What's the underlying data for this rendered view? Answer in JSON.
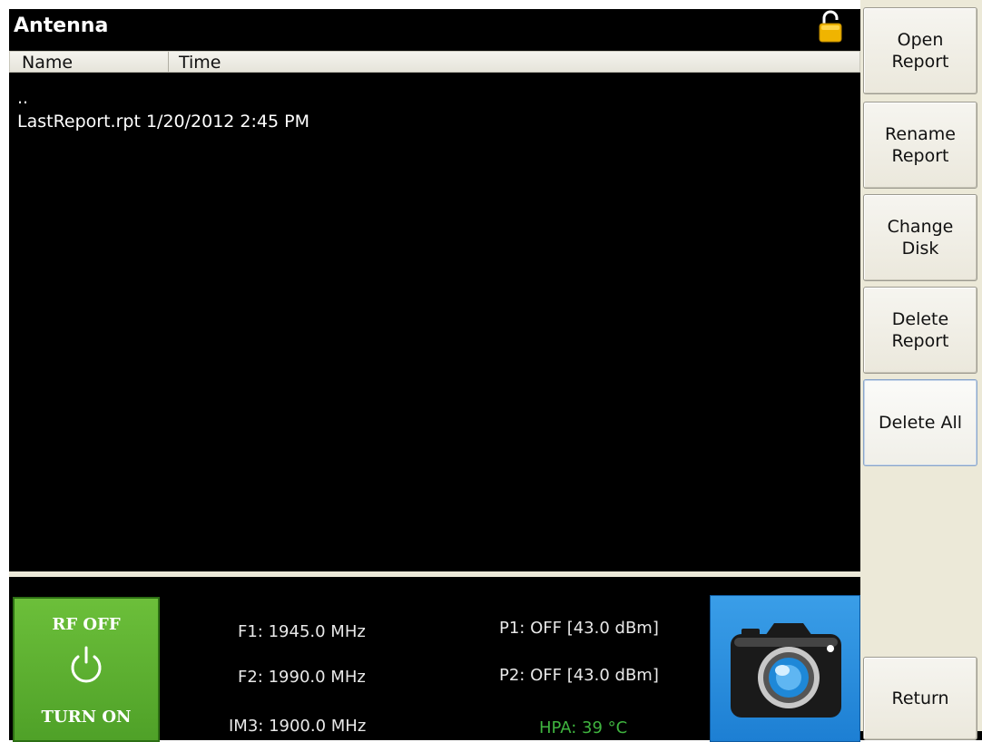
{
  "window": {
    "title": "Antenna"
  },
  "list": {
    "columns": [
      "Name",
      "Time"
    ],
    "rows": [
      {
        "text": ".."
      },
      {
        "text": "LastReport.rpt 1/20/2012 2:45 PM"
      }
    ]
  },
  "side_buttons": [
    {
      "label": "Open\nReport"
    },
    {
      "label": "Rename\nReport"
    },
    {
      "label": "Change\nDisk"
    },
    {
      "label": "Delete\nReport"
    },
    {
      "label": "Delete All"
    },
    {
      "label": "Return"
    }
  ],
  "status": {
    "rf_state": "RF OFF",
    "rf_action": "TURN ON",
    "f1": "F1: 1945.0 MHz",
    "f2": "F2: 1990.0 MHz",
    "im3": "IM3: 1900.0 MHz",
    "p1": "P1: OFF [43.0 dBm]",
    "p2": "P2: OFF [43.0 dBm]",
    "hpa": "HPA: 39 °C"
  },
  "icons": {
    "lock": "lock-icon",
    "power": "power-icon",
    "camera": "camera-icon"
  },
  "colors": {
    "rf_button": "#5aad2e",
    "camera_button": "#2a8fe0",
    "hpa_text": "#3fb43f",
    "lock": "#f0b400"
  }
}
